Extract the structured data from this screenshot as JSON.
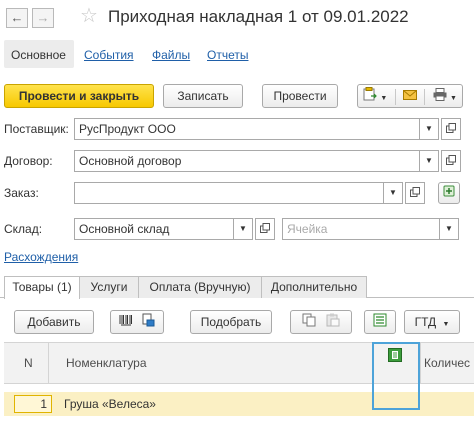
{
  "window": {
    "title": "Приходная накладная 1 от 09.01.2022",
    "back_glyph": "←",
    "forward_glyph": "→",
    "star_glyph": "☆"
  },
  "sections": [
    {
      "label": "Основное",
      "active": true
    },
    {
      "label": "События"
    },
    {
      "label": "Файлы"
    },
    {
      "label": "Отчеты"
    }
  ],
  "toolbar": {
    "post_close": "Провести и закрыть",
    "save": "Записать",
    "post": "Провести"
  },
  "form": {
    "supplier_label": "Поставщик:",
    "supplier_value": "РусПродукт ООО",
    "contract_label": "Договор:",
    "contract_value": "Основной договор",
    "order_label": "Заказ:",
    "order_value": "",
    "warehouse_label": "Склад:",
    "warehouse_value": "Основной склад",
    "cell_placeholder": "Ячейка",
    "discrepancies_link": "Расхождения"
  },
  "tabs": [
    {
      "label": "Товары (1)",
      "active": true
    },
    {
      "label": "Услуги"
    },
    {
      "label": "Оплата (Вручную)"
    },
    {
      "label": "Дополнительно"
    }
  ],
  "table_toolbar": {
    "add": "Добавить",
    "pick": "Подобрать",
    "gtd": "ГТД"
  },
  "table": {
    "columns": [
      "N",
      "Номенклатура",
      "Количес"
    ],
    "rows": [
      {
        "n": "1",
        "item": "Груша «Велеса»"
      }
    ]
  },
  "colors": {
    "primary_button": "#f7c800",
    "link": "#1f5fa8",
    "selected_row": "#fbf0c4",
    "focus_frame": "#4da3d9"
  },
  "icons": [
    "back-icon",
    "forward-icon",
    "favorite-star-icon",
    "create-based-on-icon",
    "mail-icon",
    "print-icon",
    "dropdown-arrow-icon",
    "open-icon",
    "barcode-icon",
    "scanner-icon",
    "copy-icon",
    "paste-icon",
    "distribute-icon",
    "green-flag-icon"
  ]
}
